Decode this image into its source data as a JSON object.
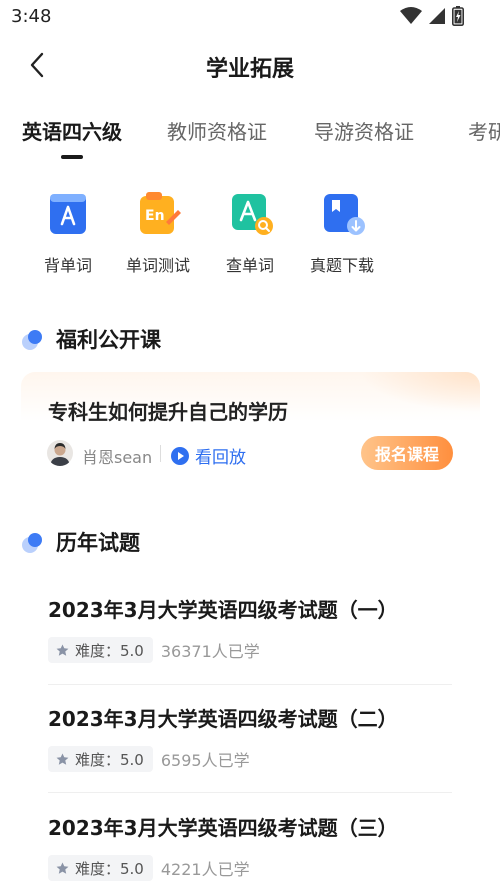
{
  "status_bar": {
    "time": "3:48"
  },
  "header": {
    "title": "学业拓展"
  },
  "tabs": [
    {
      "label": "英语四六级",
      "active": true
    },
    {
      "label": "教师资格证",
      "active": false
    },
    {
      "label": "导游资格证",
      "active": false
    },
    {
      "label": "考研",
      "active": false
    }
  ],
  "tools": [
    {
      "label": "背单词",
      "icon": "vocabulary-book-icon"
    },
    {
      "label": "单词测试",
      "icon": "word-test-icon"
    },
    {
      "label": "查单词",
      "icon": "word-search-icon"
    },
    {
      "label": "真题下载",
      "icon": "exam-download-icon"
    }
  ],
  "welfare": {
    "section_title": "福利公开课",
    "course": {
      "title": "专科生如何提升自己的学历",
      "teacher": "肖恩sean",
      "replay_label": "看回放",
      "signup_label": "报名课程"
    }
  },
  "past_exams": {
    "section_title": "历年试题",
    "items": [
      {
        "title": "2023年3月大学英语四级考试题（一）",
        "difficulty": "难度：5.0",
        "learners": "36371人已学"
      },
      {
        "title": "2023年3月大学英语四级考试题（二）",
        "difficulty": "难度：5.0",
        "learners": "6595人已学"
      },
      {
        "title": "2023年3月大学英语四级考试题（三）",
        "difficulty": "难度：5.0",
        "learners": "4221人已学"
      }
    ]
  },
  "colors": {
    "accent_blue": "#2f6ff0",
    "signup_orange": "#ff8f3e",
    "text_primary": "#1a1a1a",
    "text_secondary": "#999999"
  }
}
